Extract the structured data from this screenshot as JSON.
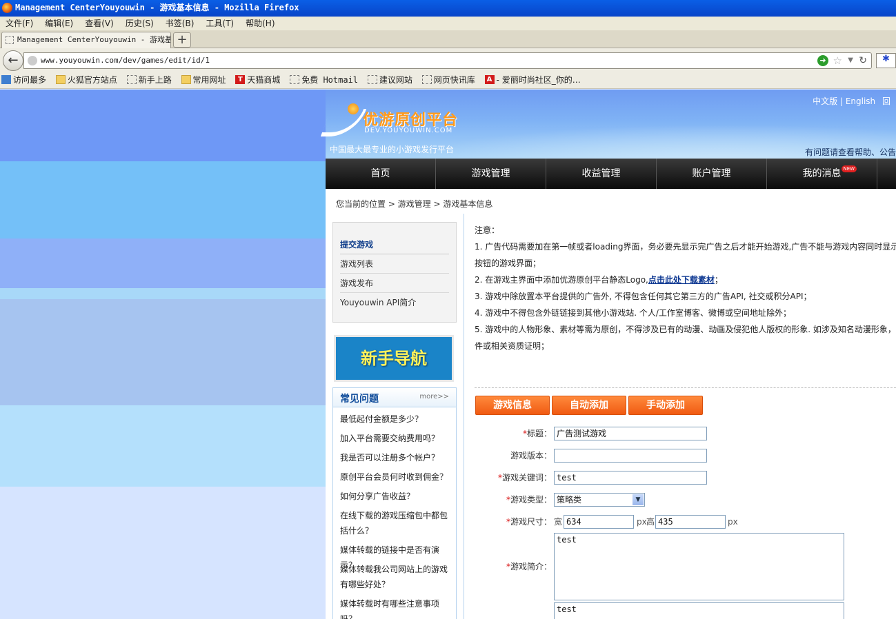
{
  "window": {
    "title": "Management CenterYouyouwin - 游戏基本信息 - Mozilla Firefox"
  },
  "menu": [
    "文件(F)",
    "编辑(E)",
    "查看(V)",
    "历史(S)",
    "书签(B)",
    "工具(T)",
    "帮助(H)"
  ],
  "tab": {
    "label": "Management CenterYouyouwin - 游戏基…",
    "new_tab": "+"
  },
  "address": {
    "url": "www.youyouwin.com/dev/games/edit/id/1"
  },
  "bookmarks": [
    {
      "label": "访问最多",
      "icon": "search-icon"
    },
    {
      "label": "火狐官方站点",
      "icon": "folder-icon"
    },
    {
      "label": "新手上路",
      "icon": "page-icon"
    },
    {
      "label": "常用网址",
      "icon": "folder-icon"
    },
    {
      "label": "天猫商城",
      "icon": "tmall-icon"
    },
    {
      "label": "免费 Hotmail",
      "icon": "page-icon"
    },
    {
      "label": "建议网站",
      "icon": "page-icon"
    },
    {
      "label": "网页快讯库",
      "icon": "page-icon"
    },
    {
      "label": "- 爱丽时尚社区_你的…",
      "icon": "aili-icon"
    }
  ],
  "header": {
    "logo_text": "优游原创平台",
    "logo_domain": "DEV.YOUYOUWIN.COM",
    "slogan": "中国最大最专业的小游戏发行平台",
    "lang_cn": "中文版",
    "lang_sep": "|",
    "lang_en": "English",
    "lang_extra": "回",
    "help_text": "有问题请查看帮助、公告"
  },
  "nav": [
    {
      "label": "首页"
    },
    {
      "label": "游戏管理"
    },
    {
      "label": "收益管理"
    },
    {
      "label": "账户管理"
    },
    {
      "label": "我的消息",
      "badge": "NEW"
    }
  ],
  "breadcrumb": "您当前的位置 > 游戏管理 > 游戏基本信息",
  "sidebar": {
    "items": [
      {
        "label": "提交游戏",
        "active": true
      },
      {
        "label": "游戏列表"
      },
      {
        "label": "游戏发布"
      },
      {
        "label": "Youyouwin API简介"
      }
    ],
    "guide_banner": "新手导航",
    "faq_title": "常见问题",
    "faq_more": "more>>",
    "faq": [
      "最低起付金额是多少？",
      "加入平台需要交纳费用吗？",
      "我是否可以注册多个帐户？",
      "原创平台会员何时收到佣金？",
      "如何分享广告收益？",
      "在线下载的游戏压缩包中都包括什么？",
      "媒体转载的链接中是否有演示？",
      "媒体转载我公司网站上的游戏有哪些好处？",
      "媒体转载时有哪些注意事项吗？"
    ]
  },
  "notes": {
    "title": "注意：",
    "n1a": "1. 广告代码需要加在第一帧或者loading界面，务必要先显示完广告之后才能开始游戏,广告不能与游戏内容同时显示",
    "n1b": "按钮的游戏界面；",
    "n2a": "2. 在游戏主界面中添加优游原创平台静态Logo,",
    "n2link": "点击此处下载素材",
    "n2b": "；",
    "n3": "3. 游戏中除放置本平台提供的广告外, 不得包含任何其它第三方的广告API, 社交或积分API；",
    "n4": "4. 游戏中不得包含外链链接到其他小游戏站. 个人/工作室博客、微博或空间地址除外；",
    "n5a": "5. 游戏中的人物形象、素材等需为原创，不得涉及已有的动漫、动画及侵犯他人版权的形象. 如涉及知名动漫形象，需",
    "n5b": "件或相关资质证明；"
  },
  "buttons": {
    "info": "游戏信息",
    "auto_add": "自动添加",
    "manual_add": "手动添加"
  },
  "form": {
    "title_label": "标题：",
    "title_value": "广告测试游戏",
    "version_label": "游戏版本：",
    "version_value": "",
    "keywords_label": "游戏关键词：",
    "keywords_value": "test",
    "type_label": "游戏类型：",
    "type_value": "策略类",
    "size_label": "游戏尺寸：",
    "width_label": "宽",
    "width_value": "634",
    "px1": "px",
    "height_label": "高",
    "height_value": "435",
    "px2": "px",
    "intro_label": "游戏简介：",
    "intro_value": "test",
    "extra_value": "test"
  }
}
